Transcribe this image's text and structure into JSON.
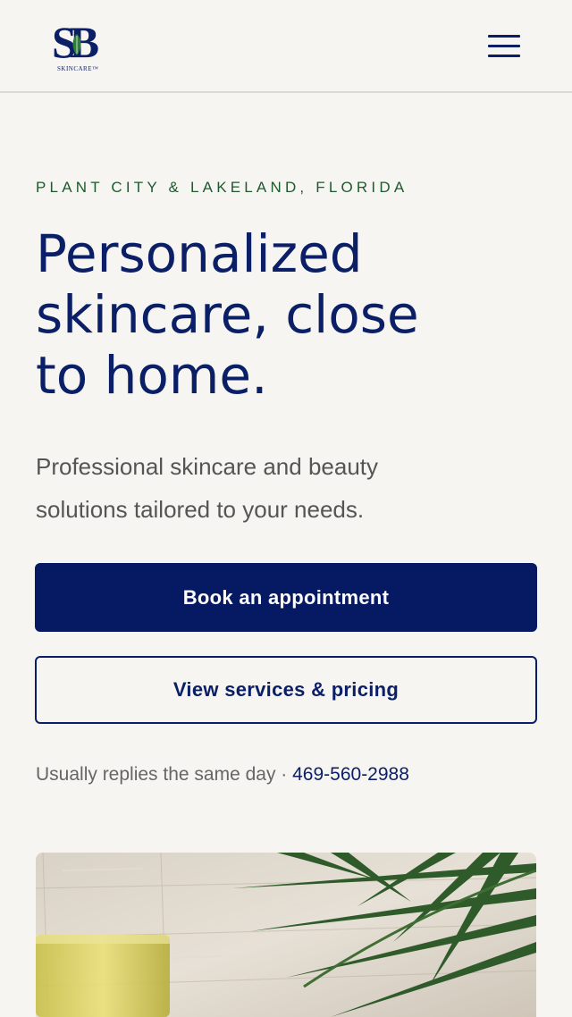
{
  "header": {
    "logo_letters": "SB",
    "logo_subtext": "SKINCARE™"
  },
  "hero": {
    "eyebrow": "PLANT CITY & LAKELAND, FLORIDA",
    "title_line1": "Personalized",
    "title_line2": "skincare, close",
    "title_line3": "to home.",
    "lead_line1": "Professional skincare and beauty",
    "lead_line2": "solutions tailored to your needs.",
    "primary_cta": "Book an appointment",
    "secondary_cta": "View services & pricing",
    "reply_text": "Usually replies the same day · ",
    "phone": "469-560-2988"
  },
  "icons": {
    "menu": "hamburger-menu-icon",
    "logo": "sb-skincare-logo"
  },
  "colors": {
    "brand_navy": "#061a63",
    "eyebrow_green": "#1d5a2e",
    "background": "#f7f5f1",
    "body_text": "#555555"
  }
}
